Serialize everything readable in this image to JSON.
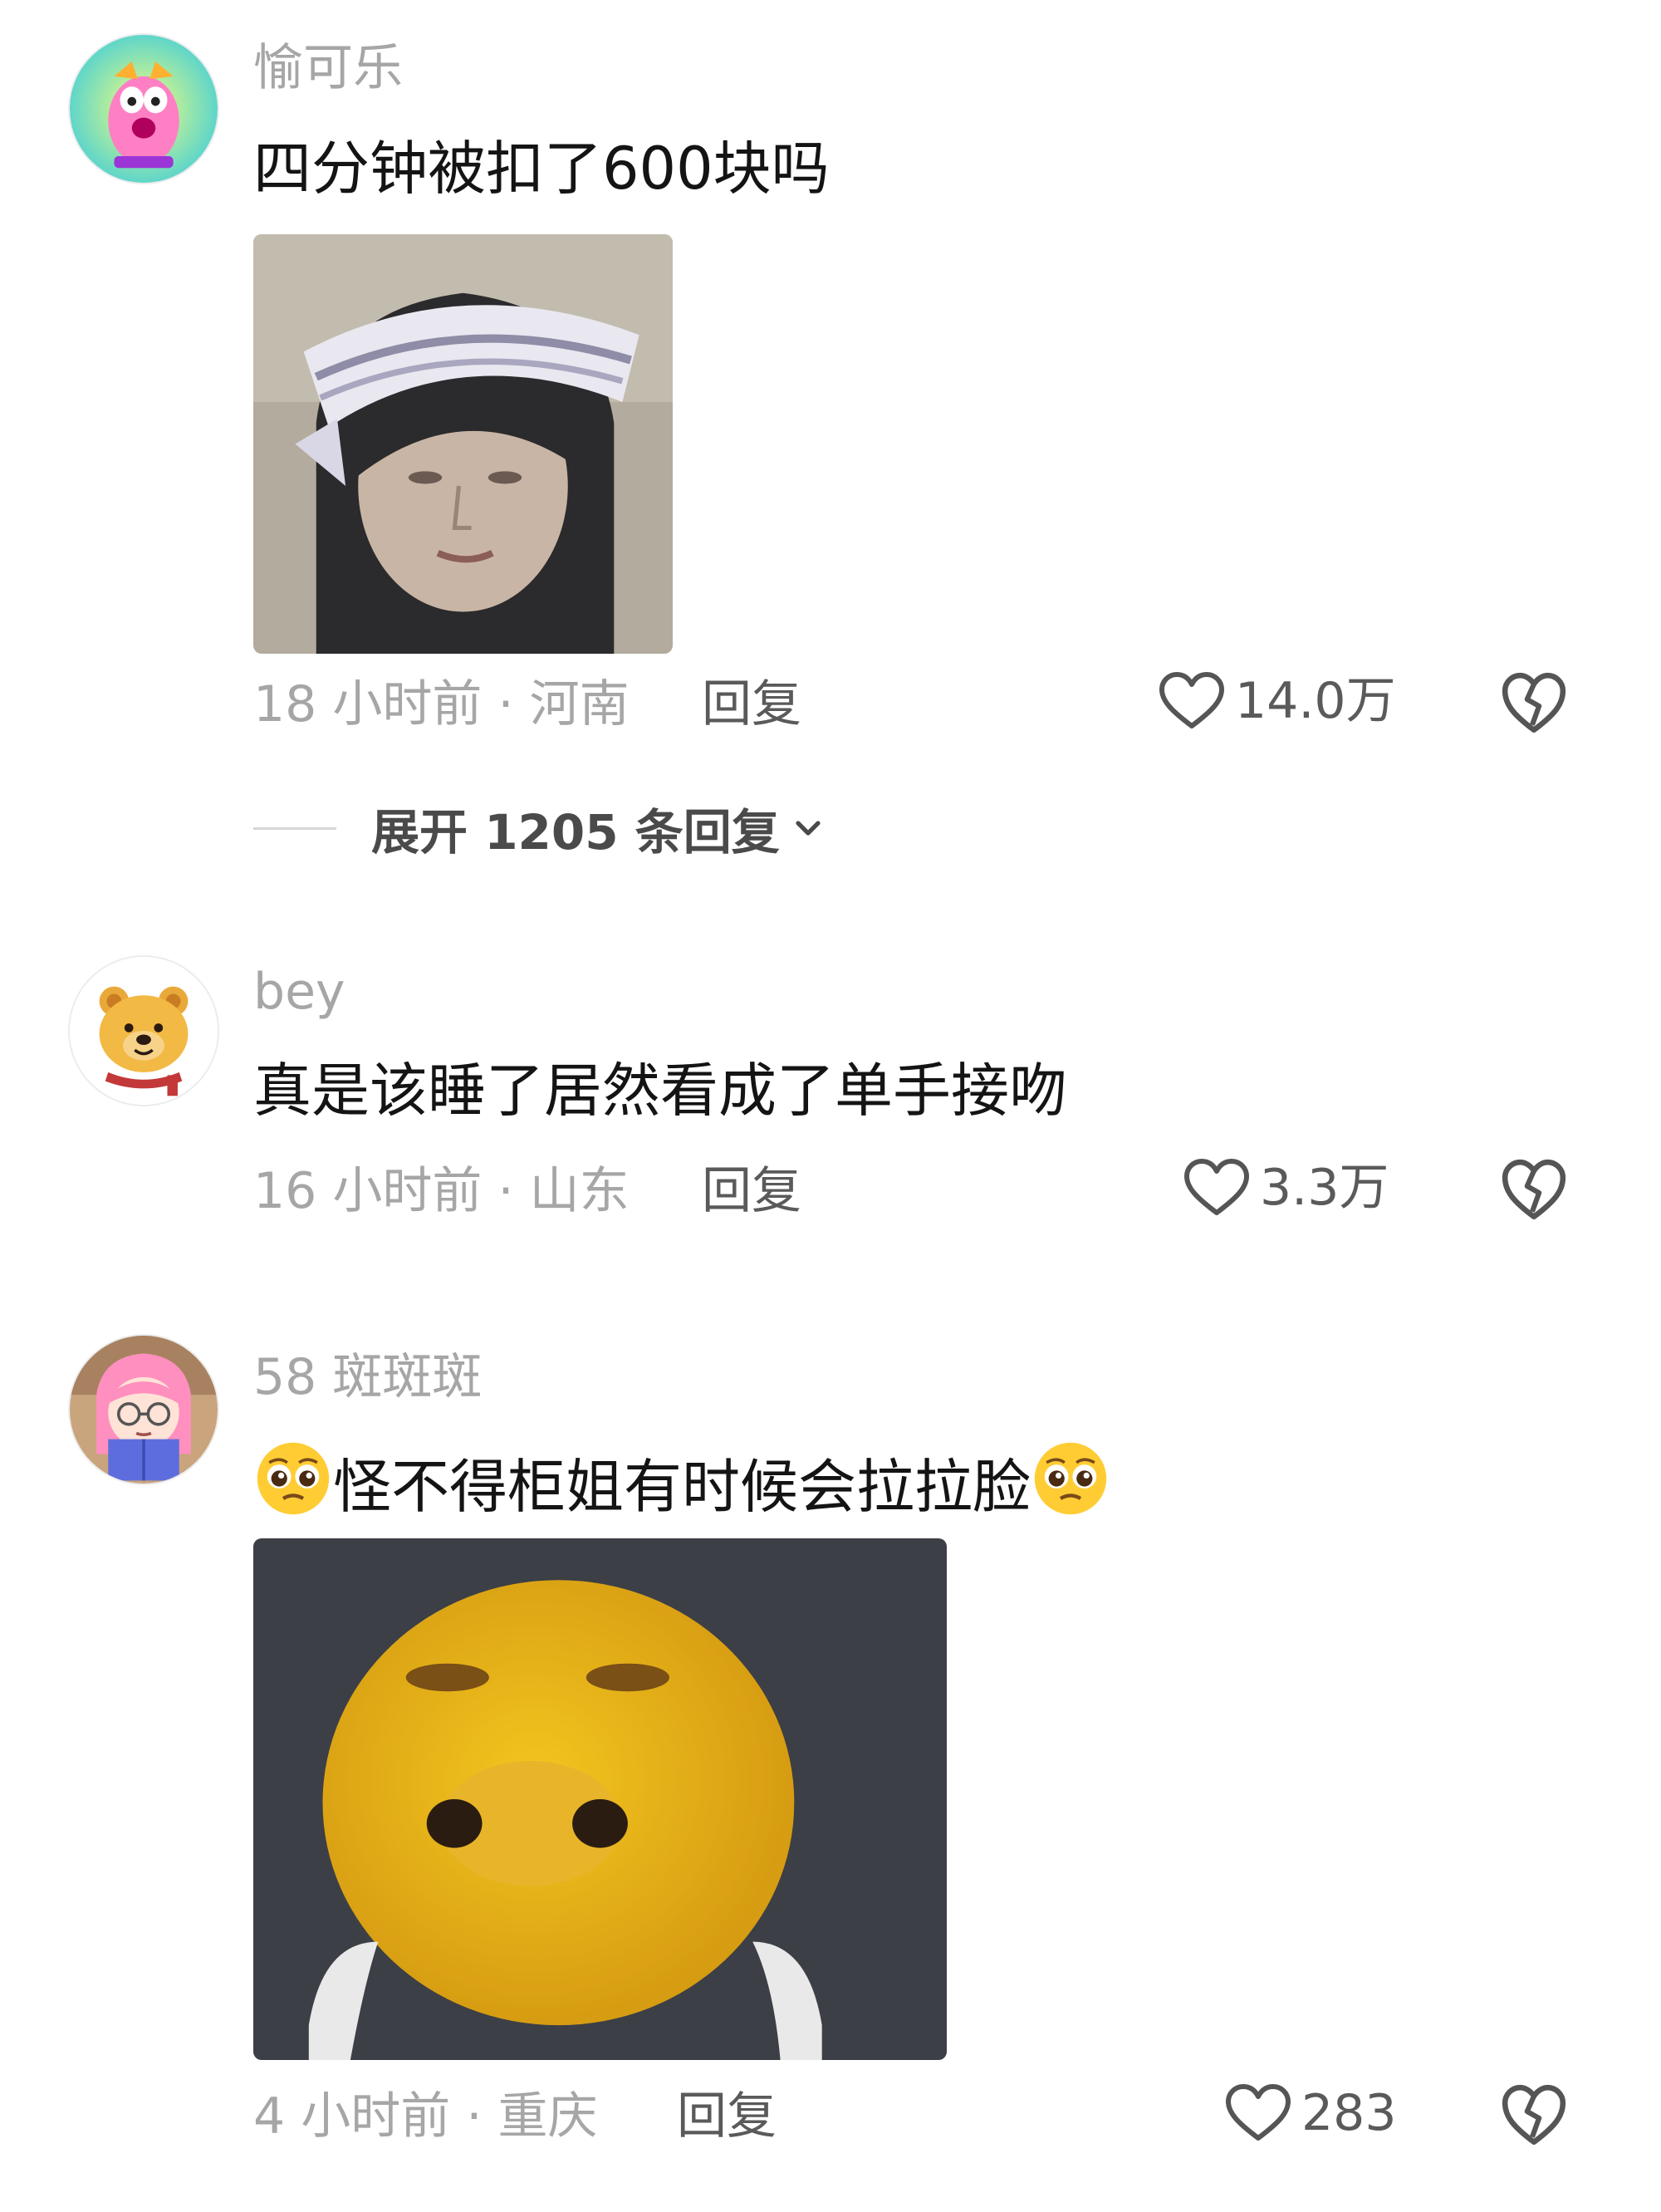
{
  "comments": [
    {
      "username": "愉可乐",
      "text": "四分钟被扣了600块吗",
      "time_location": "18 小时前 · 河南",
      "reply_label": "回复",
      "likes": "14.0万",
      "avatar_icon": "cartoon-pink-character-avatar",
      "has_image": true,
      "image_desc_icon": "girl-headband-meme-image",
      "expand_label": "展开 1205 条回复"
    },
    {
      "username": "bey",
      "text": "真是该睡了居然看成了单手接吻",
      "time_location": "16 小时前 · 山东",
      "reply_label": "回复",
      "likes": "3.3万",
      "avatar_icon": "winnie-bear-avatar"
    },
    {
      "username": "58 斑斑斑",
      "text": "怪不得柜姐有时候会拉拉脸",
      "time_location": "4 小时前 · 重庆",
      "reply_label": "回复",
      "likes": "283",
      "avatar_icon": "pink-hair-girl-reading-avatar",
      "emoji_icon": "pleading-face-emoji",
      "has_image": true,
      "image_desc_icon": "yellow-emoji-face-meme-image"
    }
  ],
  "colors": {
    "username": "#a6a6a6",
    "content": "#141414",
    "meta": "#a6a6a6",
    "action": "#5a5a5a"
  }
}
